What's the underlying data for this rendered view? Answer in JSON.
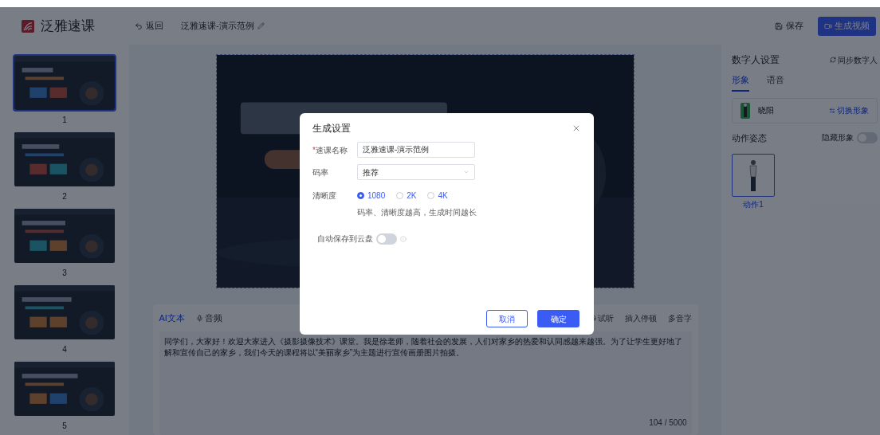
{
  "header": {
    "logo": "泛雅速课",
    "back": "返回",
    "project": "泛雅速课-演示范例",
    "save": "保存",
    "generate": "生成视频"
  },
  "slides": [
    {
      "number": "1",
      "selected": true
    },
    {
      "number": "2",
      "selected": false
    },
    {
      "number": "3",
      "selected": false
    },
    {
      "number": "4",
      "selected": false
    },
    {
      "number": "5",
      "selected": false
    }
  ],
  "editor": {
    "tabs": [
      {
        "label": "AI文本",
        "selected": true
      },
      {
        "label": "音频",
        "selected": false
      }
    ],
    "tools": [
      "试听",
      "插入停顿",
      "多音字"
    ],
    "text": "同学们，大家好！欢迎大家进入《摄影摄像技术》课堂。我是徐老师，随着社会的发展，人们对家乡的热爱和认同感越来越强。为了让学生更好地了解和宣传自己的家乡，我们今天的课程将以“美丽家乡”为主题进行宣传画册图片拍摄。",
    "counter": "104 / 5000"
  },
  "digital_human": {
    "title": "数字人设置",
    "sync": "同步数字人",
    "tabs": [
      {
        "label": "形象",
        "selected": true
      },
      {
        "label": "语音",
        "selected": false
      }
    ],
    "avatar_name": "晓阳",
    "switch": "切换形象",
    "pose_label": "动作姿态",
    "hide_label": "隐藏形象",
    "hide_on": false,
    "poses": [
      {
        "label": "动作1",
        "selected": true
      }
    ]
  },
  "dialog": {
    "title": "生成设置",
    "name_label": "速课名称",
    "required_mark": "*",
    "name_value": "泛雅速课-演示范例",
    "bitrate_label": "码率",
    "bitrate_value": "推荐",
    "resolution_label": "清晰度",
    "resolutions": [
      {
        "label": "1080",
        "selected": true
      },
      {
        "label": "2K",
        "selected": false
      },
      {
        "label": "4K",
        "selected": false
      }
    ],
    "hint": "码率、清晰度越高，生成时间越长",
    "autosave_label": "自动保存到云盘",
    "autosave_on": false,
    "cancel": "取消",
    "confirm": "确定"
  }
}
